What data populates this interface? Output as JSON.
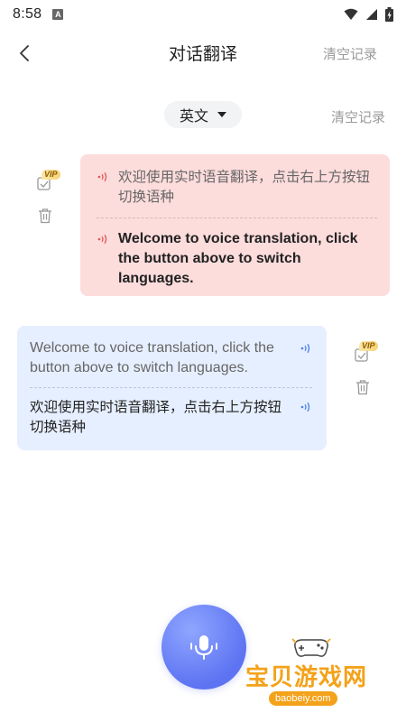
{
  "status_bar": {
    "time": "8:58",
    "indicator": "A"
  },
  "header": {
    "title": "对话翻译",
    "clear_label": "清空记录"
  },
  "language_bar": {
    "selected_language": "英文",
    "clear_label": "清空记录"
  },
  "conversation": [
    {
      "side": "right",
      "color": "#fddcdc",
      "source_text": "欢迎使用实时语音翻译，点击右上方按钮切换语种",
      "translated_text": "Welcome to voice translation, click the button above to switch languages.",
      "vip_label": "VIP"
    },
    {
      "side": "left",
      "color": "#e6efff",
      "source_text": "Welcome to voice translation, click the button above to switch languages.",
      "translated_text": "欢迎使用实时语音翻译，点击右上方按钮切换语种",
      "vip_label": "VIP"
    }
  ],
  "watermark": {
    "title": "宝贝游戏网",
    "url": "baobeiy.com"
  },
  "colors": {
    "accent": "#5d73f2",
    "speaker_red": "#e05555",
    "speaker_blue": "#4a7ee8",
    "muted_text": "#9a9a9a"
  }
}
